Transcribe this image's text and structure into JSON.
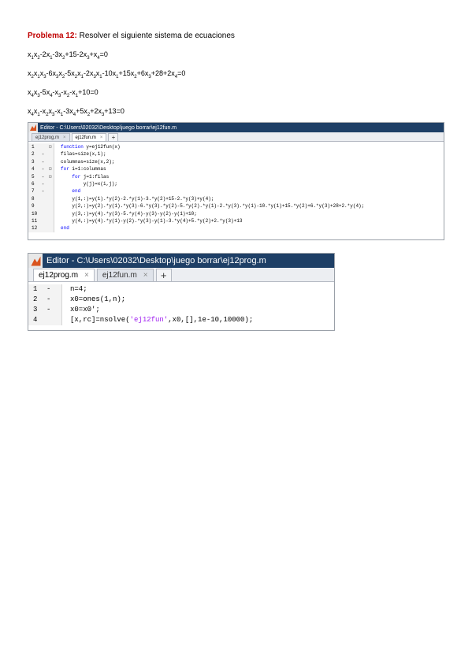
{
  "problem": {
    "label": "Problema 12:",
    "text": " Resolver el siguiente sistema de ecuaciones"
  },
  "equations": [
    [
      [
        "x",
        ""
      ],
      [
        "1",
        "sub"
      ],
      [
        "x",
        ""
      ],
      [
        "2",
        "sub"
      ],
      [
        "-2x",
        ""
      ],
      [
        "1",
        "sub"
      ],
      [
        "-3x",
        ""
      ],
      [
        "2",
        "sub"
      ],
      [
        "+15-2x",
        ""
      ],
      [
        "3",
        "sub"
      ],
      [
        "+x",
        ""
      ],
      [
        "4",
        "sub"
      ],
      [
        "=0",
        ""
      ]
    ],
    [
      [
        "x",
        ""
      ],
      [
        "2",
        "sub"
      ],
      [
        "x",
        ""
      ],
      [
        "1",
        "sub"
      ],
      [
        "x",
        ""
      ],
      [
        "3",
        "sub"
      ],
      [
        "-6x",
        ""
      ],
      [
        "3",
        "sub"
      ],
      [
        "x",
        ""
      ],
      [
        "2",
        "sub"
      ],
      [
        "-5x",
        ""
      ],
      [
        "2",
        "sub"
      ],
      [
        "x",
        ""
      ],
      [
        "1",
        "sub"
      ],
      [
        "-2x",
        ""
      ],
      [
        "3",
        "sub"
      ],
      [
        "x",
        ""
      ],
      [
        "1",
        "sub"
      ],
      [
        "-10x",
        ""
      ],
      [
        "1",
        "sub"
      ],
      [
        "+15x",
        ""
      ],
      [
        "2",
        "sub"
      ],
      [
        "+6x",
        ""
      ],
      [
        "3",
        "sub"
      ],
      [
        "+28+2x",
        ""
      ],
      [
        "4",
        "sub"
      ],
      [
        "=0",
        ""
      ]
    ],
    [
      [
        "x",
        ""
      ],
      [
        "4",
        "sub"
      ],
      [
        "x",
        ""
      ],
      [
        "3",
        "sub"
      ],
      [
        "-5x",
        ""
      ],
      [
        "4",
        "sub"
      ],
      [
        "-x",
        ""
      ],
      [
        "3",
        "sub"
      ],
      [
        "-x",
        ""
      ],
      [
        "2",
        "sub"
      ],
      [
        "-x",
        ""
      ],
      [
        "1",
        "sub"
      ],
      [
        "+10=0",
        ""
      ]
    ],
    [
      [
        "x",
        ""
      ],
      [
        "4",
        "sub"
      ],
      [
        "x",
        ""
      ],
      [
        "1",
        "sub"
      ],
      [
        "-x",
        ""
      ],
      [
        "2",
        "sub"
      ],
      [
        "x",
        ""
      ],
      [
        "3",
        "sub"
      ],
      [
        "-x",
        ""
      ],
      [
        "1",
        "sub"
      ],
      [
        "-3x",
        ""
      ],
      [
        "4",
        "sub"
      ],
      [
        "+5x",
        ""
      ],
      [
        "2",
        "sub"
      ],
      [
        "+2x",
        ""
      ],
      [
        "3",
        "sub"
      ],
      [
        "+13=0",
        ""
      ]
    ]
  ],
  "editor1": {
    "title": "Editor - C:\\Users\\02032\\Desktop\\juego borrar\\ej12fun.m",
    "tabs": [
      {
        "label": "ej12prog.m",
        "close": "×",
        "active": false
      },
      {
        "label": "ej12fun.m",
        "close": "×",
        "active": true
      }
    ],
    "add_tab": "+",
    "lines": [
      {
        "num": "1",
        "mark": "",
        "fold": "⊟",
        "segs": [
          [
            "function",
            "kw"
          ],
          [
            " y=ej12fun(x)",
            ""
          ]
        ]
      },
      {
        "num": "2",
        "mark": "-",
        "fold": "",
        "segs": [
          [
            "filas=size(x,1);",
            ""
          ]
        ]
      },
      {
        "num": "3",
        "mark": "-",
        "fold": "",
        "segs": [
          [
            "columnas=size(x,2);",
            ""
          ]
        ]
      },
      {
        "num": "4",
        "mark": "-",
        "fold": "⊟",
        "segs": [
          [
            "for",
            "kw"
          ],
          [
            " i=1:columnas",
            ""
          ]
        ]
      },
      {
        "num": "5",
        "mark": "-",
        "fold": "⊟",
        "segs": [
          [
            "    ",
            ""
          ],
          [
            "for",
            "kw"
          ],
          [
            " j=1:filas",
            ""
          ]
        ]
      },
      {
        "num": "6",
        "mark": "-",
        "fold": "",
        "segs": [
          [
            "        y(j)=x(i,j);",
            ""
          ]
        ]
      },
      {
        "num": "7",
        "mark": "-",
        "fold": "",
        "segs": [
          [
            "    ",
            ""
          ],
          [
            "end",
            "kw"
          ]
        ]
      },
      {
        "num": "8",
        "mark": "",
        "fold": "",
        "segs": [
          [
            "    y(1,:)=y(1).*y(2)-2.*y(1)-3.*y(2)+15-2.*y(3)+y(4);",
            ""
          ]
        ]
      },
      {
        "num": "9",
        "mark": "",
        "fold": "",
        "segs": [
          [
            "    y(2,:)=y(2).*y(1).*y(3)-6.*y(3).*y(2)-5.*y(2).*y(1)-2.*y(3).*y(1)-10.*y(1)+15.*y(2)+6.*y(3)+28+2.*y(4);",
            ""
          ]
        ]
      },
      {
        "num": "10",
        "mark": "",
        "fold": "",
        "segs": [
          [
            "    y(3,:)=y(4).*y(3)-5.*y(4)-y(3)-y(2)-y(1)+10;",
            ""
          ]
        ]
      },
      {
        "num": "11",
        "mark": "",
        "fold": "",
        "segs": [
          [
            "    y(4,:)=y(4).*y(1)-y(2).*y(3)-y(1)-3.*y(4)+5.*y(2)+2.*y(3)+13",
            ""
          ]
        ]
      },
      {
        "num": "12",
        "mark": "",
        "fold": "",
        "segs": [
          [
            "end",
            "kw"
          ]
        ]
      }
    ]
  },
  "editor2": {
    "title": "Editor - C:\\Users\\02032\\Desktop\\juego borrar\\ej12prog.m",
    "tabs": [
      {
        "label": "ej12prog.m",
        "close": "×",
        "active": true
      },
      {
        "label": "ej12fun.m",
        "close": "×",
        "active": false
      }
    ],
    "add_tab": "+",
    "lines": [
      {
        "num": "1",
        "mark": "-",
        "fold": "",
        "segs": [
          [
            "n=4;",
            ""
          ]
        ]
      },
      {
        "num": "2",
        "mark": "-",
        "fold": "",
        "segs": [
          [
            "x0=ones(1,n);",
            ""
          ]
        ]
      },
      {
        "num": "3",
        "mark": "-",
        "fold": "",
        "segs": [
          [
            "x0=x0';",
            ""
          ]
        ]
      },
      {
        "num": "4",
        "mark": "",
        "fold": "",
        "segs": [
          [
            "[x,rc]=nsolve(",
            ""
          ],
          [
            "'ej12fun'",
            "str"
          ],
          [
            ",x0,[],1e-10,10000);",
            ""
          ]
        ]
      }
    ]
  }
}
